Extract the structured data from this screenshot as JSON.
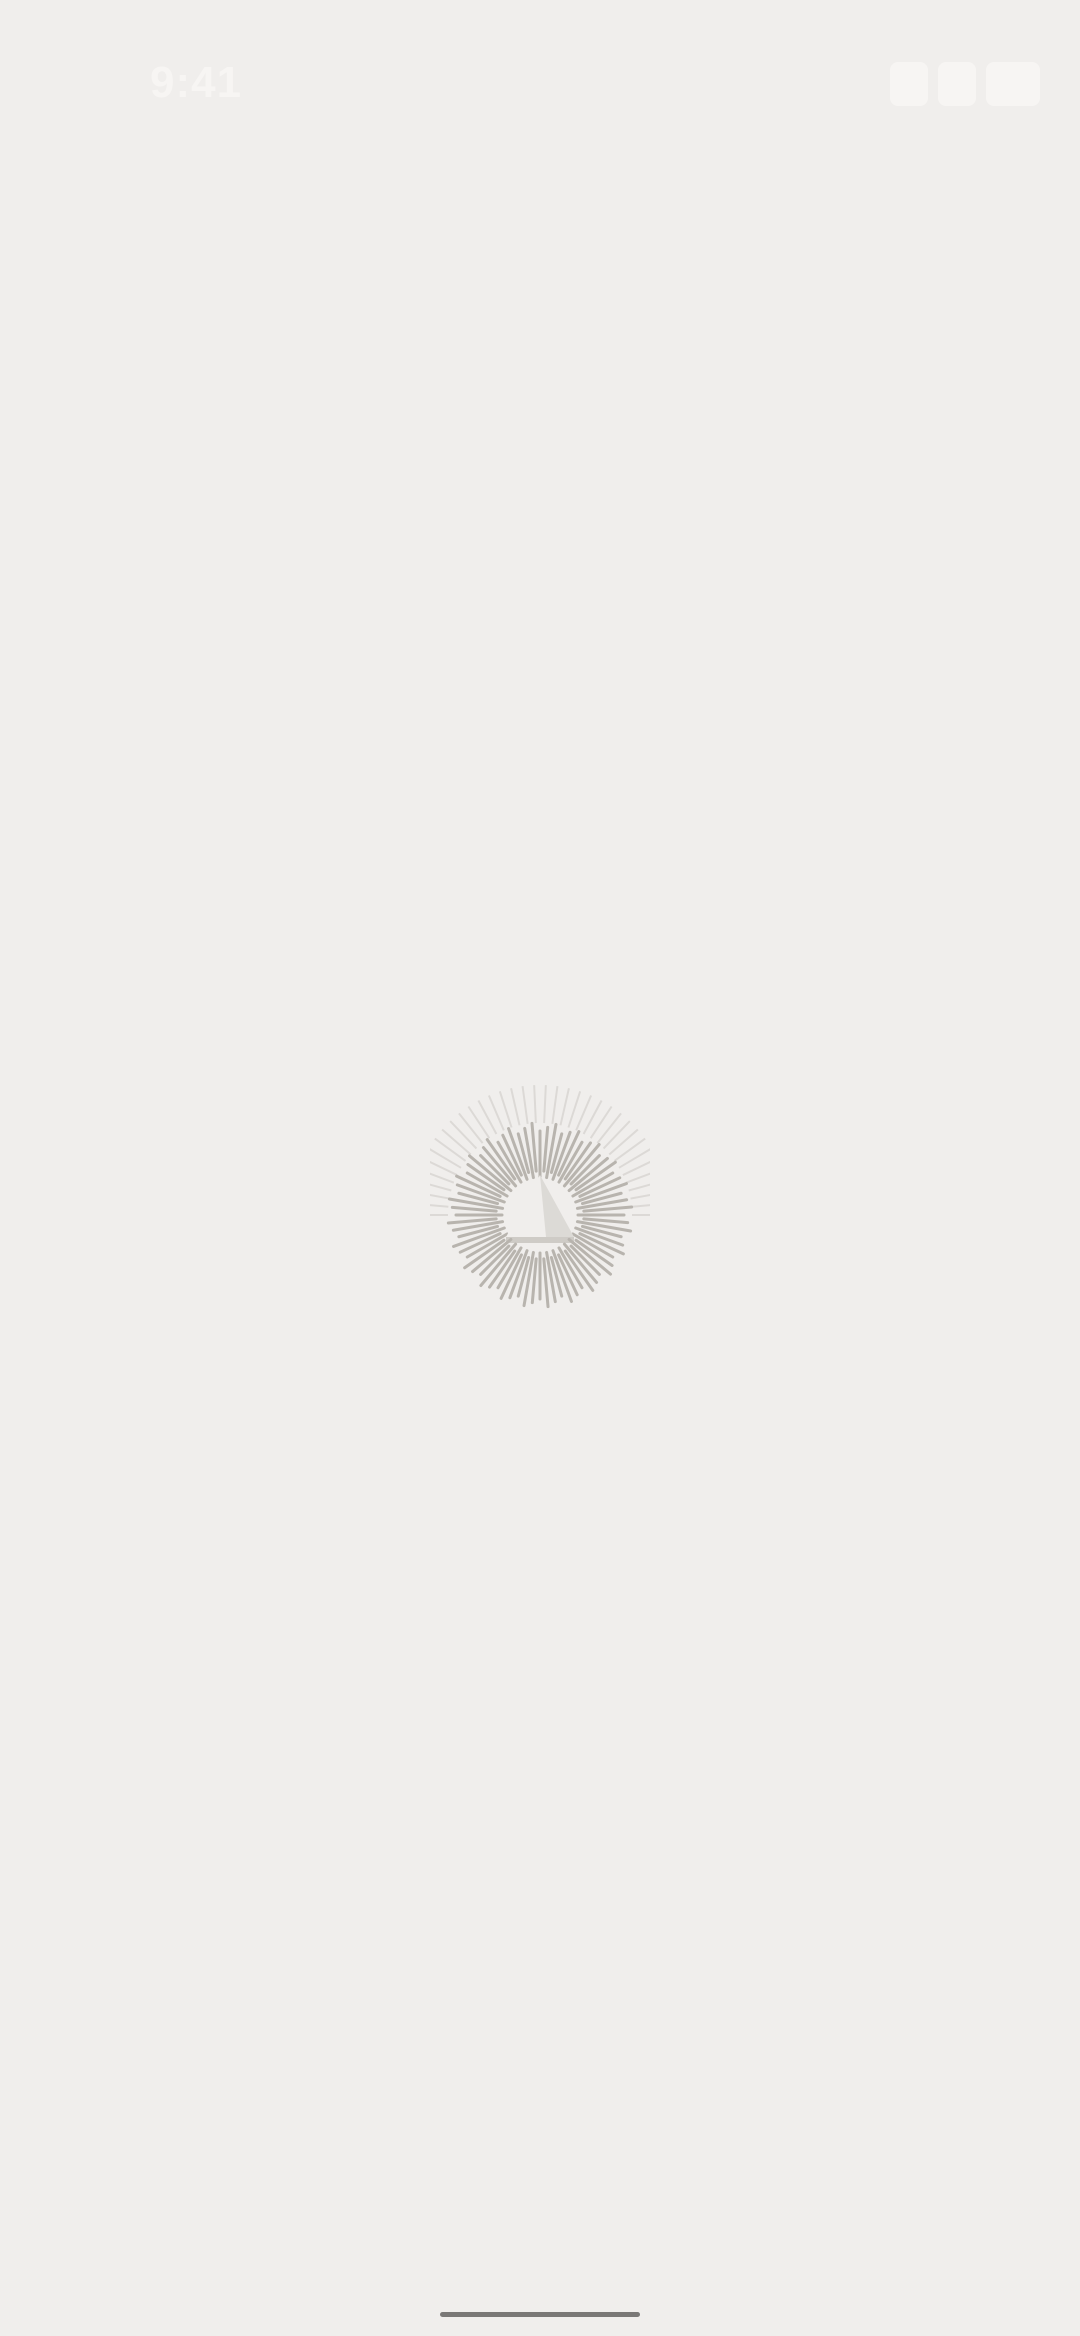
{
  "status_bar": {
    "time": "9:41"
  },
  "splash": {
    "logo_icon": "radiant-triangle-logo-icon",
    "logo_color": "#b8b4ae",
    "background_color": "#f0eeec"
  },
  "home_indicator": {
    "color": "#7a7876"
  }
}
